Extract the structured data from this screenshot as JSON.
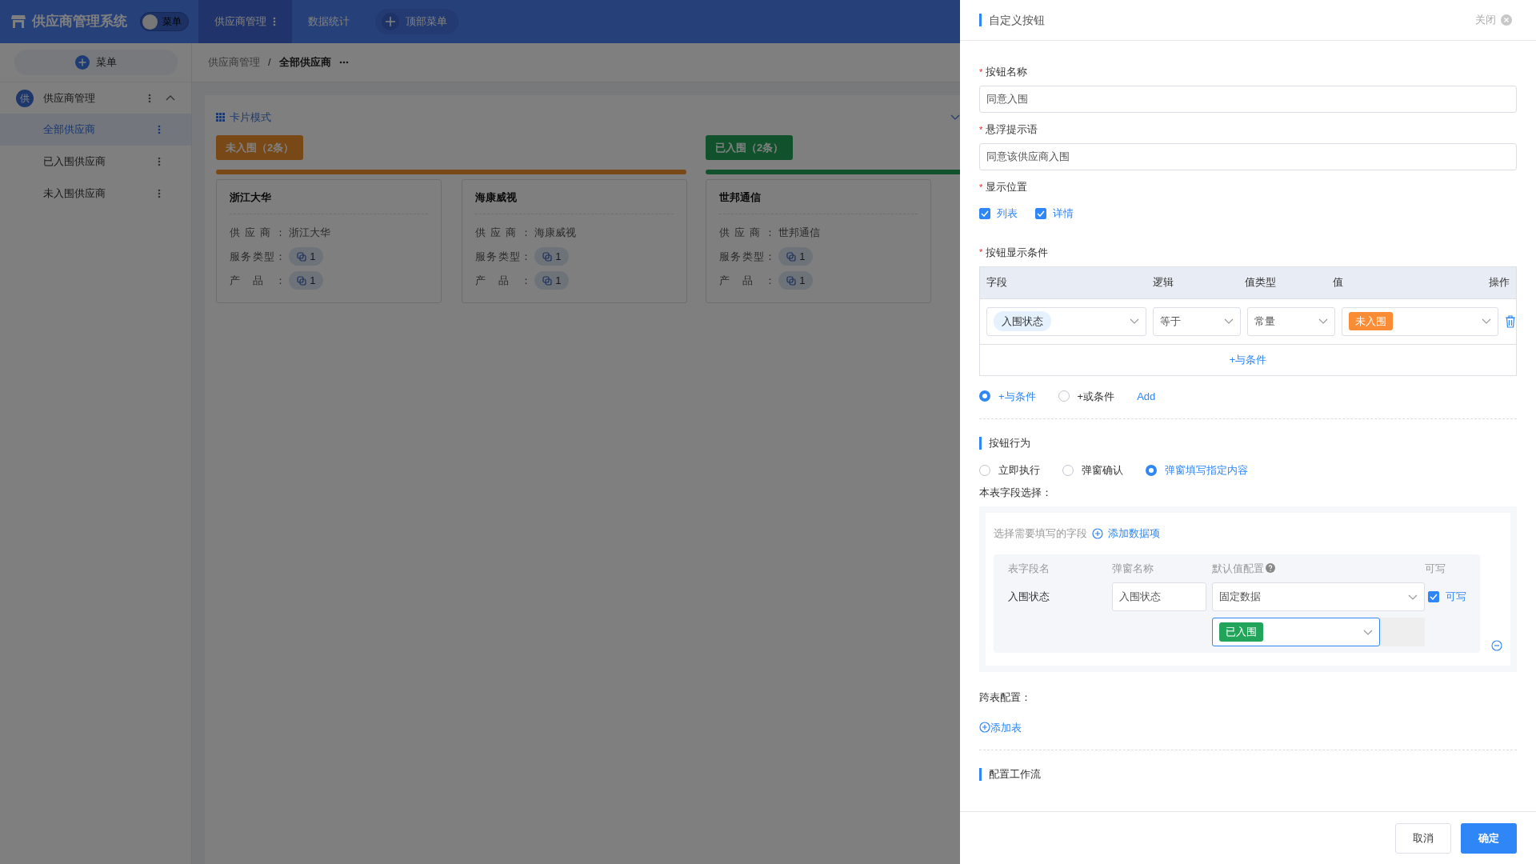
{
  "app": {
    "title": "供应商管理系统",
    "toggle": {
      "label": "菜单",
      "on": false
    }
  },
  "top_nav": [
    {
      "label": "供应商管理",
      "selected": true
    },
    {
      "label": "数据统计",
      "selected": false
    }
  ],
  "top_add": "顶部菜单",
  "sidebar": {
    "add_label": "菜单",
    "groups": [
      {
        "badge": "供",
        "label": "供应商管理",
        "expanded": true,
        "children": [
          {
            "label": "全部供应商",
            "selected": true
          },
          {
            "label": "已入围供应商",
            "selected": false
          },
          {
            "label": "未入围供应商",
            "selected": false
          }
        ]
      }
    ]
  },
  "breadcrumb": {
    "items": [
      "供应商管理",
      "全部供应商"
    ],
    "separator": "/"
  },
  "view_mode": "卡片模式",
  "columns": [
    {
      "title": "未入围（2条）",
      "kind": "pending",
      "cards": [
        {
          "name": "浙江大华",
          "fields": [
            {
              "label": "供应商：",
              "value": "浙江大华"
            },
            {
              "label": "服务类型：",
              "count": "1"
            },
            {
              "label": "产品：",
              "count": "1"
            }
          ]
        },
        {
          "name": "海康威视",
          "fields": [
            {
              "label": "供应商：",
              "value": "海康威视"
            },
            {
              "label": "服务类型：",
              "count": "1"
            },
            {
              "label": "产品：",
              "count": "1"
            }
          ]
        }
      ]
    },
    {
      "title": "已入围（2条）",
      "kind": "admitted",
      "cards": [
        {
          "name": "世邦通信",
          "fields": [
            {
              "label": "供应商：",
              "value": "世邦通信"
            },
            {
              "label": "服务类型：",
              "count": "1"
            },
            {
              "label": "产品：",
              "count": "1"
            }
          ]
        }
      ]
    }
  ],
  "drawer": {
    "title": "自定义按钮",
    "close": "关闭",
    "fields": [
      {
        "label": "按钮名称",
        "mark": "*",
        "value": "同意入围"
      },
      {
        "label": "悬浮提示语",
        "mark": "*",
        "value": "同意该供应商入围"
      }
    ],
    "display": {
      "label": "显示位置",
      "mark": "*",
      "options": [
        {
          "label": "列表",
          "checked": true
        },
        {
          "label": "详情",
          "checked": true
        }
      ]
    },
    "conditions": {
      "label": "按钮显示条件",
      "mark": "*",
      "columns": [
        "字段",
        "逻辑",
        "值类型",
        "值",
        "操作"
      ],
      "rows": [
        {
          "field": "入围状态",
          "logic": "等于",
          "value_type": "常量",
          "value": "未入围"
        }
      ],
      "add": "+与条件"
    },
    "joins": [
      {
        "label": "+与条件",
        "selected": true
      },
      {
        "label": "+或条件",
        "selected": false
      }
    ],
    "add_link": "Add",
    "behavior": {
      "title": "按钮行为",
      "options": [
        {
          "label": "立即执行",
          "selected": false
        },
        {
          "label": "弹窗确认",
          "selected": false
        },
        {
          "label": "弹窗填写指定内容",
          "selected": true
        }
      ],
      "fields_label": "本表字段选择：",
      "hint": "选择需要填写的字段",
      "add_item": "添加数据项",
      "table": {
        "columns": [
          "表字段名",
          "弹窗名称",
          "默认值配置",
          "可写"
        ],
        "rows": [
          {
            "field": "入围状态",
            "popup_name": "入围状态",
            "default_type": "固定数据",
            "default_value": "已入围",
            "writable": {
              "label": "可写",
              "checked": true
            }
          }
        ]
      }
    },
    "cross": {
      "label": "跨表配置：",
      "add": "添加表"
    },
    "workflow": {
      "title": "配置工作流"
    },
    "footer": {
      "cancel": "取消",
      "ok": "确定"
    }
  }
}
